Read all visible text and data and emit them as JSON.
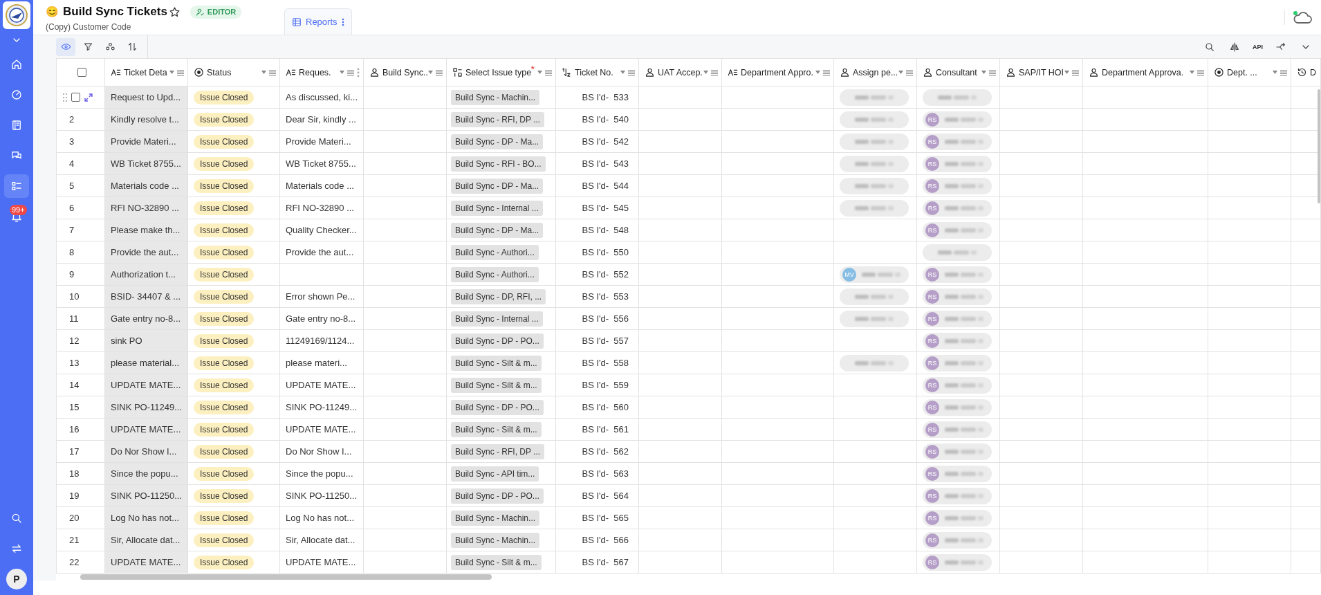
{
  "header": {
    "emoji": "😊",
    "title": "Build Sync Tickets",
    "badge": "EDITOR",
    "subtitle": "(Copy) Customer Code"
  },
  "tabs": [
    {
      "label": "Reports",
      "selected": true
    }
  ],
  "sidebar": {
    "items": [
      {
        "kind": "home",
        "selected": false
      },
      {
        "kind": "gauge",
        "selected": false
      },
      {
        "kind": "book",
        "selected": false
      },
      {
        "kind": "chat",
        "selected": false
      },
      {
        "kind": "list",
        "selected": true
      },
      {
        "kind": "bell",
        "selected": false,
        "badge": "99+"
      }
    ],
    "bottom": [
      {
        "kind": "search"
      },
      {
        "kind": "swap"
      }
    ],
    "avatar": "P"
  },
  "toolbar": {
    "left": [
      {
        "kind": "eye",
        "selected": true
      },
      {
        "kind": "filter",
        "selected": false
      },
      {
        "kind": "group",
        "selected": false
      },
      {
        "kind": "sort",
        "selected": false
      }
    ],
    "right": [
      {
        "kind": "search"
      },
      {
        "kind": "split"
      },
      {
        "kind": "api",
        "label": "API"
      },
      {
        "kind": "share"
      },
      {
        "kind": "chevron"
      }
    ]
  },
  "table": {
    "columns": [
      {
        "kind": "checkbox",
        "checked": false
      },
      {
        "kind": "text",
        "label": "Ticket Deta"
      },
      {
        "kind": "status",
        "label": "Status"
      },
      {
        "kind": "text",
        "label": "Reques.",
        "more": true
      },
      {
        "kind": "person",
        "label": "Build Sync.."
      },
      {
        "kind": "select",
        "label": "Select Issue type",
        "marker": "*"
      },
      {
        "kind": "number",
        "label": "Ticket No."
      },
      {
        "kind": "person",
        "label": "UAT Accep."
      },
      {
        "kind": "text",
        "label": "Department Appro."
      },
      {
        "kind": "person",
        "label": "Assign pe..."
      },
      {
        "kind": "person",
        "label": "Consultant"
      },
      {
        "kind": "person",
        "label": "SAP/IT HOI"
      },
      {
        "kind": "person",
        "label": "Department Approva."
      },
      {
        "kind": "status",
        "label": "Dept. ..."
      },
      {
        "kind": "history",
        "label": "D"
      }
    ],
    "rows": [
      {
        "hovered": true,
        "checked": false,
        "details": "Request to Upd...",
        "status": "Issue Closed",
        "request": "As discussed, ki...",
        "issue": "Build Sync - Machin...",
        "ticket": "BS I'd-  533",
        "assign": {
          "kind": "blurred"
        },
        "consultant": {
          "kind": "blurred"
        }
      },
      {
        "hovered": false,
        "number": "2",
        "details": "Kindly resolve t...",
        "status": "Issue Closed",
        "request": "Dear Sir, kindly ...",
        "issue": "Build Sync - RFI, DP ...",
        "ticket": "BS I'd-  540",
        "assign": {
          "kind": "blurred"
        },
        "consultant": {
          "kind": "avatar",
          "initials": "RS",
          "color": "#b59ec8"
        }
      },
      {
        "hovered": false,
        "number": "3",
        "details": "Provide Materi...",
        "status": "Issue Closed",
        "request": "Provide Materi...",
        "issue": "Build Sync - DP - Ma...",
        "ticket": "BS I'd-  542",
        "assign": {
          "kind": "blurred"
        },
        "consultant": {
          "kind": "avatar",
          "initials": "RS",
          "color": "#b59ec8"
        }
      },
      {
        "hovered": false,
        "number": "4",
        "details": "WB Ticket 8755...",
        "status": "Issue Closed",
        "request": "WB Ticket 8755...",
        "issue": "Build Sync - RFI - BO...",
        "ticket": "BS I'd-  543",
        "assign": {
          "kind": "blurred"
        },
        "consultant": {
          "kind": "avatar",
          "initials": "RS",
          "color": "#b59ec8"
        }
      },
      {
        "hovered": false,
        "number": "5",
        "details": "Materials code ...",
        "status": "Issue Closed",
        "request": "Materials code ...",
        "issue": "Build Sync - DP - Ma...",
        "ticket": "BS I'd-  544",
        "assign": {
          "kind": "blurred"
        },
        "consultant": {
          "kind": "avatar",
          "initials": "RS",
          "color": "#b59ec8"
        }
      },
      {
        "hovered": false,
        "number": "6",
        "details": "RFI NO-32890 ...",
        "status": "Issue Closed",
        "request": "RFI NO-32890 ...",
        "issue": "Build Sync - Internal ...",
        "ticket": "BS I'd-  545",
        "assign": {
          "kind": "blurred"
        },
        "consultant": {
          "kind": "avatar",
          "initials": "RS",
          "color": "#b59ec8"
        }
      },
      {
        "hovered": false,
        "number": "7",
        "details": "Please make th...",
        "status": "Issue Closed",
        "request": "Quality Checker...",
        "issue": "Build Sync - DP - Ma...",
        "ticket": "BS I'd-  548",
        "consultant": {
          "kind": "avatar",
          "initials": "RS",
          "color": "#b59ec8"
        }
      },
      {
        "hovered": false,
        "number": "8",
        "details": "Provide the aut...",
        "status": "Issue Closed",
        "request": "Provide the aut...",
        "issue": "Build Sync - Authori...",
        "ticket": "BS I'd-  550",
        "consultant": {
          "kind": "blurred"
        }
      },
      {
        "hovered": false,
        "number": "9",
        "details": "Authorization t...",
        "status": "Issue Closed",
        "issue": "Build Sync - Authori...",
        "ticket": "BS I'd-  552",
        "assign": {
          "kind": "avatar",
          "initials": "MV",
          "color": "#86bde4"
        },
        "consultant": {
          "kind": "avatar",
          "initials": "RS",
          "color": "#b59ec8"
        }
      },
      {
        "hovered": false,
        "number": "10",
        "details": "BSID- 34407 & ...",
        "status": "Issue Closed",
        "request": "Error shown Pe...",
        "issue": "Build Sync - DP, RFI, ...",
        "ticket": "BS I'd-  553",
        "assign": {
          "kind": "blurred"
        },
        "consultant": {
          "kind": "avatar",
          "initials": "RS",
          "color": "#b59ec8"
        }
      },
      {
        "hovered": false,
        "number": "11",
        "details": "Gate entry no-8...",
        "status": "Issue Closed",
        "request": "Gate entry no-8...",
        "issue": "Build Sync - Internal ...",
        "ticket": "BS I'd-  556",
        "assign": {
          "kind": "blurred"
        },
        "consultant": {
          "kind": "avatar",
          "initials": "RS",
          "color": "#b59ec8"
        }
      },
      {
        "hovered": false,
        "number": "12",
        "details": "sink PO",
        "status": "Issue Closed",
        "request": "11249169/1124...",
        "issue": "Build Sync - DP - PO...",
        "ticket": "BS I'd-  557",
        "consultant": {
          "kind": "avatar",
          "initials": "RS",
          "color": "#b59ec8"
        }
      },
      {
        "hovered": false,
        "number": "13",
        "details": "please material...",
        "status": "Issue Closed",
        "request": "please materi...",
        "issue": "Build Sync - Silt & m...",
        "ticket": "BS I'd-  558",
        "assign": {
          "kind": "blurred"
        },
        "consultant": {
          "kind": "avatar",
          "initials": "RS",
          "color": "#b59ec8"
        }
      },
      {
        "hovered": false,
        "number": "14",
        "details": "UPDATE MATE...",
        "status": "Issue Closed",
        "request": "UPDATE MATE...",
        "issue": "Build Sync - Silt & m...",
        "ticket": "BS I'd-  559",
        "consultant": {
          "kind": "avatar",
          "initials": "RS",
          "color": "#b59ec8"
        }
      },
      {
        "hovered": false,
        "number": "15",
        "details": "SINK PO-11249...",
        "status": "Issue Closed",
        "request": "SINK PO-11249...",
        "issue": "Build Sync - DP - PO...",
        "ticket": "BS I'd-  560",
        "consultant": {
          "kind": "avatar",
          "initials": "RS",
          "color": "#b59ec8"
        }
      },
      {
        "hovered": false,
        "number": "16",
        "details": "UPDATE MATE...",
        "status": "Issue Closed",
        "request": "UPDATE MATE...",
        "issue": "Build Sync - Silt & m...",
        "ticket": "BS I'd-  561",
        "consultant": {
          "kind": "avatar",
          "initials": "RS",
          "color": "#b59ec8"
        }
      },
      {
        "hovered": false,
        "number": "17",
        "details": "Do Nor Show I...",
        "status": "Issue Closed",
        "request": "Do Nor Show I...",
        "issue": "Build Sync - RFI, DP ...",
        "ticket": "BS I'd-  562",
        "consultant": {
          "kind": "avatar",
          "initials": "RS",
          "color": "#b59ec8"
        }
      },
      {
        "hovered": false,
        "number": "18",
        "details": "Since the popu...",
        "status": "Issue Closed",
        "request": "Since the popu...",
        "issue": "Build Sync - API tim...",
        "ticket": "BS I'd-  563",
        "consultant": {
          "kind": "avatar",
          "initials": "RS",
          "color": "#b59ec8"
        }
      },
      {
        "hovered": false,
        "number": "19",
        "details": "SINK PO-11250...",
        "status": "Issue Closed",
        "request": "SINK PO-11250...",
        "issue": "Build Sync - DP - PO...",
        "ticket": "BS I'd-  564",
        "consultant": {
          "kind": "avatar",
          "initials": "RS",
          "color": "#b59ec8"
        }
      },
      {
        "hovered": false,
        "number": "20",
        "details": "Log No has not...",
        "status": "Issue Closed",
        "request": "Log No has not...",
        "issue": "Build Sync - Machin...",
        "ticket": "BS I'd-  565",
        "consultant": {
          "kind": "avatar",
          "initials": "RS",
          "color": "#b59ec8"
        }
      },
      {
        "hovered": false,
        "number": "21",
        "details": "Sir, Allocate dat...",
        "status": "Issue Closed",
        "request": "Sir, Allocate dat...",
        "issue": "Build Sync - Machin...",
        "ticket": "BS I'd-  566",
        "consultant": {
          "kind": "avatar",
          "initials": "RS",
          "color": "#b59ec8"
        }
      },
      {
        "hovered": false,
        "number": "22",
        "details": "UPDATE MATE...",
        "status": "Issue Closed",
        "request": "UPDATE MATE...",
        "issue": "Build Sync - Silt & m...",
        "ticket": "BS I'd-  567",
        "consultant": {
          "kind": "avatar",
          "initials": "RS",
          "color": "#b59ec8"
        }
      }
    ]
  }
}
